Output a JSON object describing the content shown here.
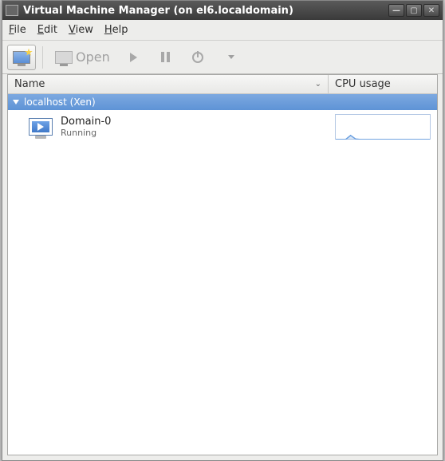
{
  "window": {
    "title": "Virtual Machine Manager (on el6.localdomain)"
  },
  "menu": {
    "file": "File",
    "edit": "Edit",
    "view": "View",
    "help": "Help"
  },
  "toolbar": {
    "open_label": "Open"
  },
  "columns": {
    "name": "Name",
    "cpu": "CPU usage"
  },
  "host": {
    "label": "localhost (Xen)"
  },
  "vm": {
    "name": "Domain-0",
    "status": "Running"
  },
  "chart_data": {
    "type": "line",
    "title": "",
    "xlabel": "",
    "ylabel": "",
    "ylim": [
      0,
      100
    ],
    "x": [
      0,
      1,
      2,
      3,
      4,
      5,
      6,
      7,
      8,
      9,
      10,
      11,
      12,
      13,
      14,
      15,
      16,
      17,
      18,
      19
    ],
    "values": [
      2,
      2,
      2,
      18,
      4,
      2,
      2,
      2,
      2,
      2,
      2,
      2,
      2,
      2,
      2,
      2,
      2,
      2,
      2,
      2
    ]
  }
}
